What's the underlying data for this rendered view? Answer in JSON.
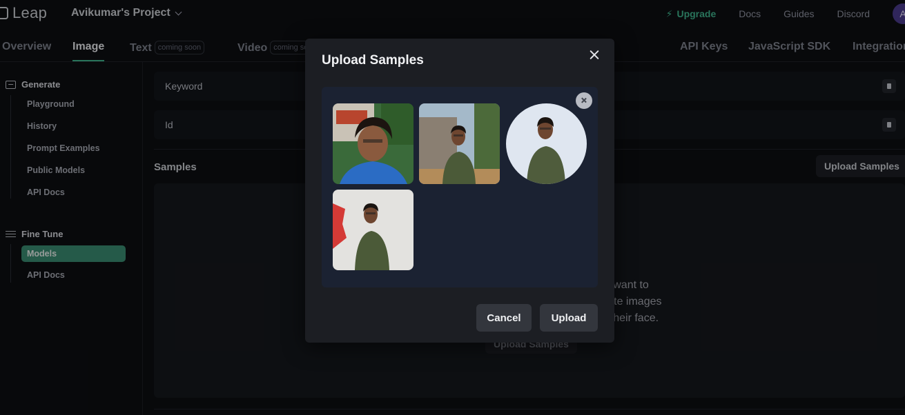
{
  "header": {
    "logo_text": "Leap",
    "project_name": "Avikumar's Project",
    "upgrade_label": "Upgrade",
    "links": [
      "Docs",
      "Guides",
      "Discord"
    ],
    "avatar_initial": "A"
  },
  "tabs": {
    "overview": "Overview",
    "image": "Image",
    "text": "Text",
    "text_badge": "coming soon",
    "video": "Video",
    "video_badge": "coming soon",
    "api_keys": "API Keys",
    "js_sdk": "JavaScript SDK",
    "integrations": "Integrations"
  },
  "sidebar": {
    "generate_title": "Generate",
    "generate_items": [
      "Playground",
      "History",
      "Prompt Examples",
      "Public Models",
      "API Docs"
    ],
    "finetune_title": "Fine Tune",
    "finetune_items": [
      "Models",
      "API Docs"
    ]
  },
  "main": {
    "keyword_label": "Keyword",
    "id_label": "Id",
    "samples_title": "Samples",
    "upload_samples_label": "Upload Samples",
    "empty_lines": [
      "ou want to",
      "erate images",
      "of their face."
    ],
    "empty_button_label": "Upload Samples"
  },
  "modal": {
    "title": "Upload Samples",
    "sample_count": 4,
    "cancel_label": "Cancel",
    "upload_label": "Upload"
  },
  "colors": {
    "accent": "#3fb38d",
    "active_item_bg": "#3a8a71",
    "modal_bg": "#1c1e23",
    "drop_zone_bg": "#1b2232"
  }
}
